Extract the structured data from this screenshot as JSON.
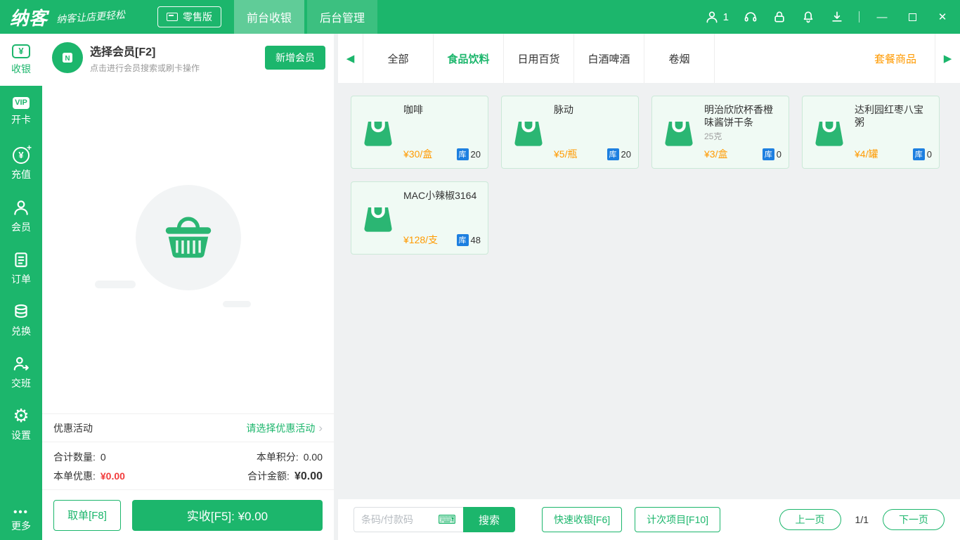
{
  "icons": {
    "yen": "¥",
    "plus": "+",
    "vip": "VIP",
    "gear": "⚙",
    "dots": "•••",
    "left_arrow": "◀",
    "right_arrow": "▶",
    "chevron": "›",
    "keyboard": "⌨",
    "minimize": "—",
    "close": "✕"
  },
  "topbar": {
    "logo": "纳客",
    "slogan": "纳客让店更轻松",
    "edition": "零售版",
    "tabs": [
      {
        "label": "前台收银"
      },
      {
        "label": "后台管理"
      }
    ],
    "user_count": "1"
  },
  "sidebar": {
    "items": [
      {
        "label": "收银"
      },
      {
        "label": "开卡"
      },
      {
        "label": "充值"
      },
      {
        "label": "会员"
      },
      {
        "label": "订单"
      },
      {
        "label": "兑换"
      },
      {
        "label": "交班"
      },
      {
        "label": "设置"
      }
    ],
    "more_label": "更多"
  },
  "member_panel": {
    "title": "选择会员[F2]",
    "subtitle": "点击进行会员搜索或刷卡操作",
    "add_button": "新增会员",
    "promo_label": "优惠活动",
    "promo_action": "请选择优惠活动",
    "totals": {
      "qty_label": "合计数量:",
      "qty_value": "0",
      "points_label": "本单积分:",
      "points_value": "0.00",
      "discount_label": "本单优惠:",
      "discount_value": "¥0.00",
      "amount_label": "合计金额:",
      "amount_value": "¥0.00"
    },
    "hold_button": "取单[F8]",
    "pay_button": "实收[F5]:  ¥0.00"
  },
  "catalog": {
    "categories": [
      {
        "label": "全部"
      },
      {
        "label": "食品饮料"
      },
      {
        "label": "日用百货"
      },
      {
        "label": "白酒啤酒"
      },
      {
        "label": "卷烟"
      }
    ],
    "combo_label": "套餐商品",
    "stock_badge": "库",
    "products": [
      {
        "name": "咖啡",
        "spec": "",
        "price": "¥30/盒",
        "stock": "20"
      },
      {
        "name": "脉动",
        "spec": "",
        "price": "¥5/瓶",
        "stock": "20"
      },
      {
        "name": "明治欣欣杯香橙味酱饼干条",
        "spec": "25克",
        "price": "¥3/盒",
        "stock": "0"
      },
      {
        "name": "达利园红枣八宝粥",
        "spec": "",
        "price": "¥4/罐",
        "stock": "0"
      },
      {
        "name": "MAC小辣椒3164",
        "spec": "",
        "price": "¥128/支",
        "stock": "48"
      }
    ]
  },
  "bottom_bar": {
    "search_placeholder": "条码/付款码",
    "search_button": "搜索",
    "quick_cashier_button": "快速收银[F6]",
    "count_item_button": "计次项目[F10]",
    "prev_button": "上一页",
    "page_indicator": "1/1",
    "next_button": "下一页"
  },
  "colors": {
    "primary_green": "#1CB66C",
    "price_orange": "#FF9A00",
    "stock_blue": "#1D7FE0",
    "discount_red": "#F23C3C"
  }
}
